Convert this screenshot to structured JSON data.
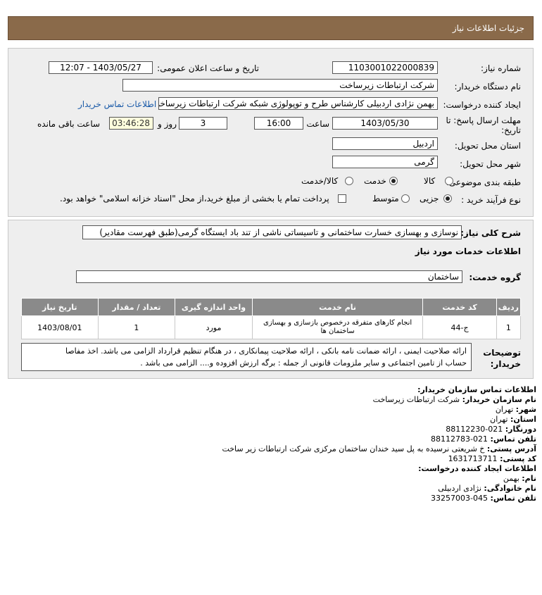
{
  "header": {
    "title": "جزئیات اطلاعات نیاز"
  },
  "form": {
    "need_number_label": "شماره نیاز:",
    "need_number": "1103001022000839",
    "announce_label": "تاریخ و ساعت اعلان عمومی:",
    "announce_value": "1403/05/27 - 12:07",
    "buyer_org_label": "نام دستگاه خریدار:",
    "buyer_org": "شرکت ارتباطات زیرساخت",
    "creator_label": "ایجاد کننده درخواست:",
    "creator": "بهمن نژادی اردبیلی کارشناس طرح و توپولوژی شبکه شرکت ارتباطات زیرساخت",
    "contact_link": "اطلاعات تماس خریدار",
    "deadline_label_1": "مهلت ارسال پاسخ: تا",
    "deadline_label_2": "تاریخ:",
    "deadline_date": "1403/05/30",
    "time_label": "ساعت",
    "deadline_time": "16:00",
    "days_value": "3",
    "days_label": "روز و",
    "remaining_time": "03:46:28",
    "remaining_label": "ساعت باقی مانده",
    "province_label": "استان محل تحویل:",
    "province": "اردبیل",
    "city_label": "شهر محل تحویل:",
    "city": "گرمی",
    "category_label": "طبقه بندی موضوعی:",
    "category_options": [
      "کالا",
      "خدمت",
      "کالا/خدمت"
    ],
    "category_selected": "خدمت",
    "process_label": "نوع فرآیند خرید :",
    "process_options": [
      "جزیی",
      "متوسط"
    ],
    "process_selected": "جزیی",
    "treasury_text": "پرداخت تمام یا بخشی از مبلغ خرید،از محل \"اسناد خزانه اسلامی\" خواهد بود."
  },
  "description": {
    "label": "شرح کلی نیاز:",
    "value": "نوسازی و بهسازی خسارت ساختمانی و تاسیساتی ناشی از تند باد ایستگاه گرمی(طبق فهرست مقادیر)"
  },
  "services": {
    "section_title": "اطلاعات خدمات مورد نیاز",
    "group_label": "گروه خدمت:",
    "group_value": "ساختمان",
    "columns": [
      "ردیف",
      "کد خدمت",
      "نام خدمت",
      "واحد اندازه گیری",
      "تعداد / مقدار",
      "تاریخ نیاز"
    ],
    "rows": [
      [
        "1",
        "ج-44",
        "انجام کارهای متفرقه درخصوص بازسازی و بهسازی ساختمان ها",
        "مورد",
        "1",
        "1403/08/01"
      ]
    ]
  },
  "buyer_notes": {
    "label_1": "توضیحات",
    "label_2": "خریدار:",
    "line_1": "ارائه صلاحیت ایمنی ، ارائه ضمانت نامه بانکی ، ارائه صلاحیت پیمانکاری ، در هنگام تنظیم قرارداد الزامی می باشد. اخذ مفاصا",
    "line_2": "حساب از تامین اجتماعی و سایر ملزومات قانونی از جمله : برگه ارزش افزوده و.... الزامی می باشد ."
  },
  "contact": {
    "title": "اطلاعات تماس سازمان خریدار:",
    "org_label": "نام سازمان خریدار:",
    "org": "شرکت ارتباطات زیرساخت",
    "city_label": "شهر:",
    "city": "تهران",
    "province_label": "استان:",
    "province": "تهران",
    "fax_label": "دورنگار:",
    "fax": "021-88112230",
    "phone_label": "تلفن تماس:",
    "phone": "021-88112783",
    "address_label": "آدرس پستی:",
    "address": "خ شریعتی نرسیده به پل سید خندان ساختمان مرکزی شرکت ارتباطات زیر ساخت",
    "postal_label": "کد پستی:",
    "postal": "1631713711",
    "creator_title": "اطلاعات ایجاد کننده درخواست:",
    "name_label": "نام:",
    "name": "بهمن",
    "family_label": "نام خانوادگی:",
    "family": "نژادی اردبیلی",
    "creator_phone_label": "تلفن تماس:",
    "creator_phone": "045-33257003"
  }
}
